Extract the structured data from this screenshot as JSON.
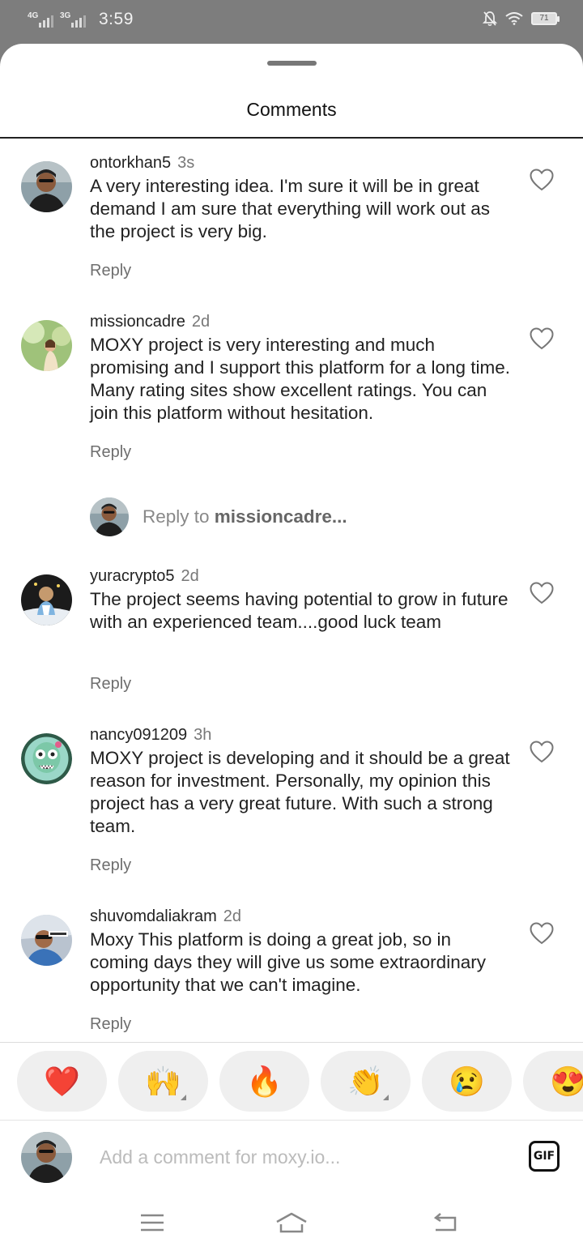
{
  "status_bar": {
    "net1": "4G",
    "net2": "3G",
    "time": "3:59",
    "battery": "71"
  },
  "sheet": {
    "title": "Comments"
  },
  "comments": [
    {
      "username": "ontorkhan5",
      "age": "3s",
      "text": "A very interesting idea. I'm sure it will be in great demand I am sure that everything will work out as the project is very big.",
      "reply_label": "Reply"
    },
    {
      "username": "missioncadre",
      "age": "2d",
      "text": "MOXY project is very interesting and much promising and I support this platform for a long time. Many rating sites show excellent ratings. You can join this platform without hesitation.",
      "reply_label": "Reply"
    },
    {
      "username": "yuracrypto5",
      "age": "2d",
      "text": "The project seems having potential to grow in future with an experienced team....good luck team",
      "reply_label": "Reply"
    },
    {
      "username": "nancy091209",
      "age": "3h",
      "text": "MOXY project is developing and it should be a great reason for investment. Personally, my opinion this project has a very great future. With such a strong team.",
      "reply_label": "Reply"
    },
    {
      "username": "shuvomdaliakram",
      "age": "2d",
      "text": "Moxy This platform is doing a great job, so in coming days they will give us some extraordinary opportunity that we can't imagine.",
      "reply_label": "Reply"
    }
  ],
  "reply_prompt": {
    "prefix": "Reply to ",
    "target": "missioncadre..."
  },
  "emoji_reactions": [
    "❤️",
    "🙌",
    "🔥",
    "👏",
    "😢",
    "😍"
  ],
  "composer": {
    "placeholder": "Add a comment for moxy.io...",
    "gif_label": "GIF"
  },
  "colors": {
    "text": "#222222",
    "secondary_text": "#777777",
    "pill_bg": "#efefef",
    "overlay": "#7d7d7d"
  }
}
